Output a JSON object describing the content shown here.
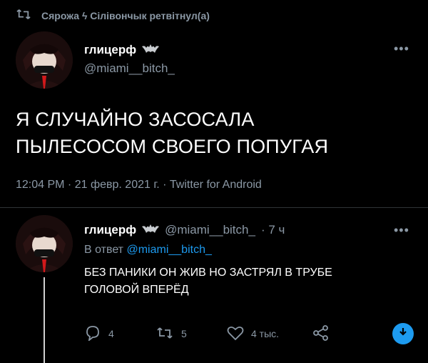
{
  "retweet": {
    "icon": "retweet-icon",
    "text": "Сярожа ϟ Сілівончык ретвітнул(а)"
  },
  "tweet": {
    "author_name": "глицерф",
    "handle": "@miami__bitch_",
    "text_line1": "Я СЛУЧАЙНО ЗАСОСАЛА",
    "text_line2": "ПЫЛЕСОСОМ СВОЕГО ПОПУГАЯ",
    "meta": "12:04 PM · 21 февр. 2021 г. · Twitter for Android",
    "more_icon": "more-horizontal-icon"
  },
  "reply": {
    "author_name": "глицерф",
    "handle": "@miami__bitch_",
    "time": "· 7 ч",
    "reply_to_label": "В ответ",
    "reply_to_handle": "@miami__bitch_",
    "text_line1": "БЕЗ ПАНИКИ ОН ЖИВ НО ЗАСТРЯЛ В ТРУБЕ",
    "text_line2": "ГОЛОВОЙ ВПЕРЁД",
    "actions": {
      "reply_count": "4",
      "retweet_count": "5",
      "like_count": "4 тыс."
    }
  },
  "colors": {
    "accent": "#1d9bf0",
    "muted": "#8b98a5",
    "background": "#000000"
  }
}
